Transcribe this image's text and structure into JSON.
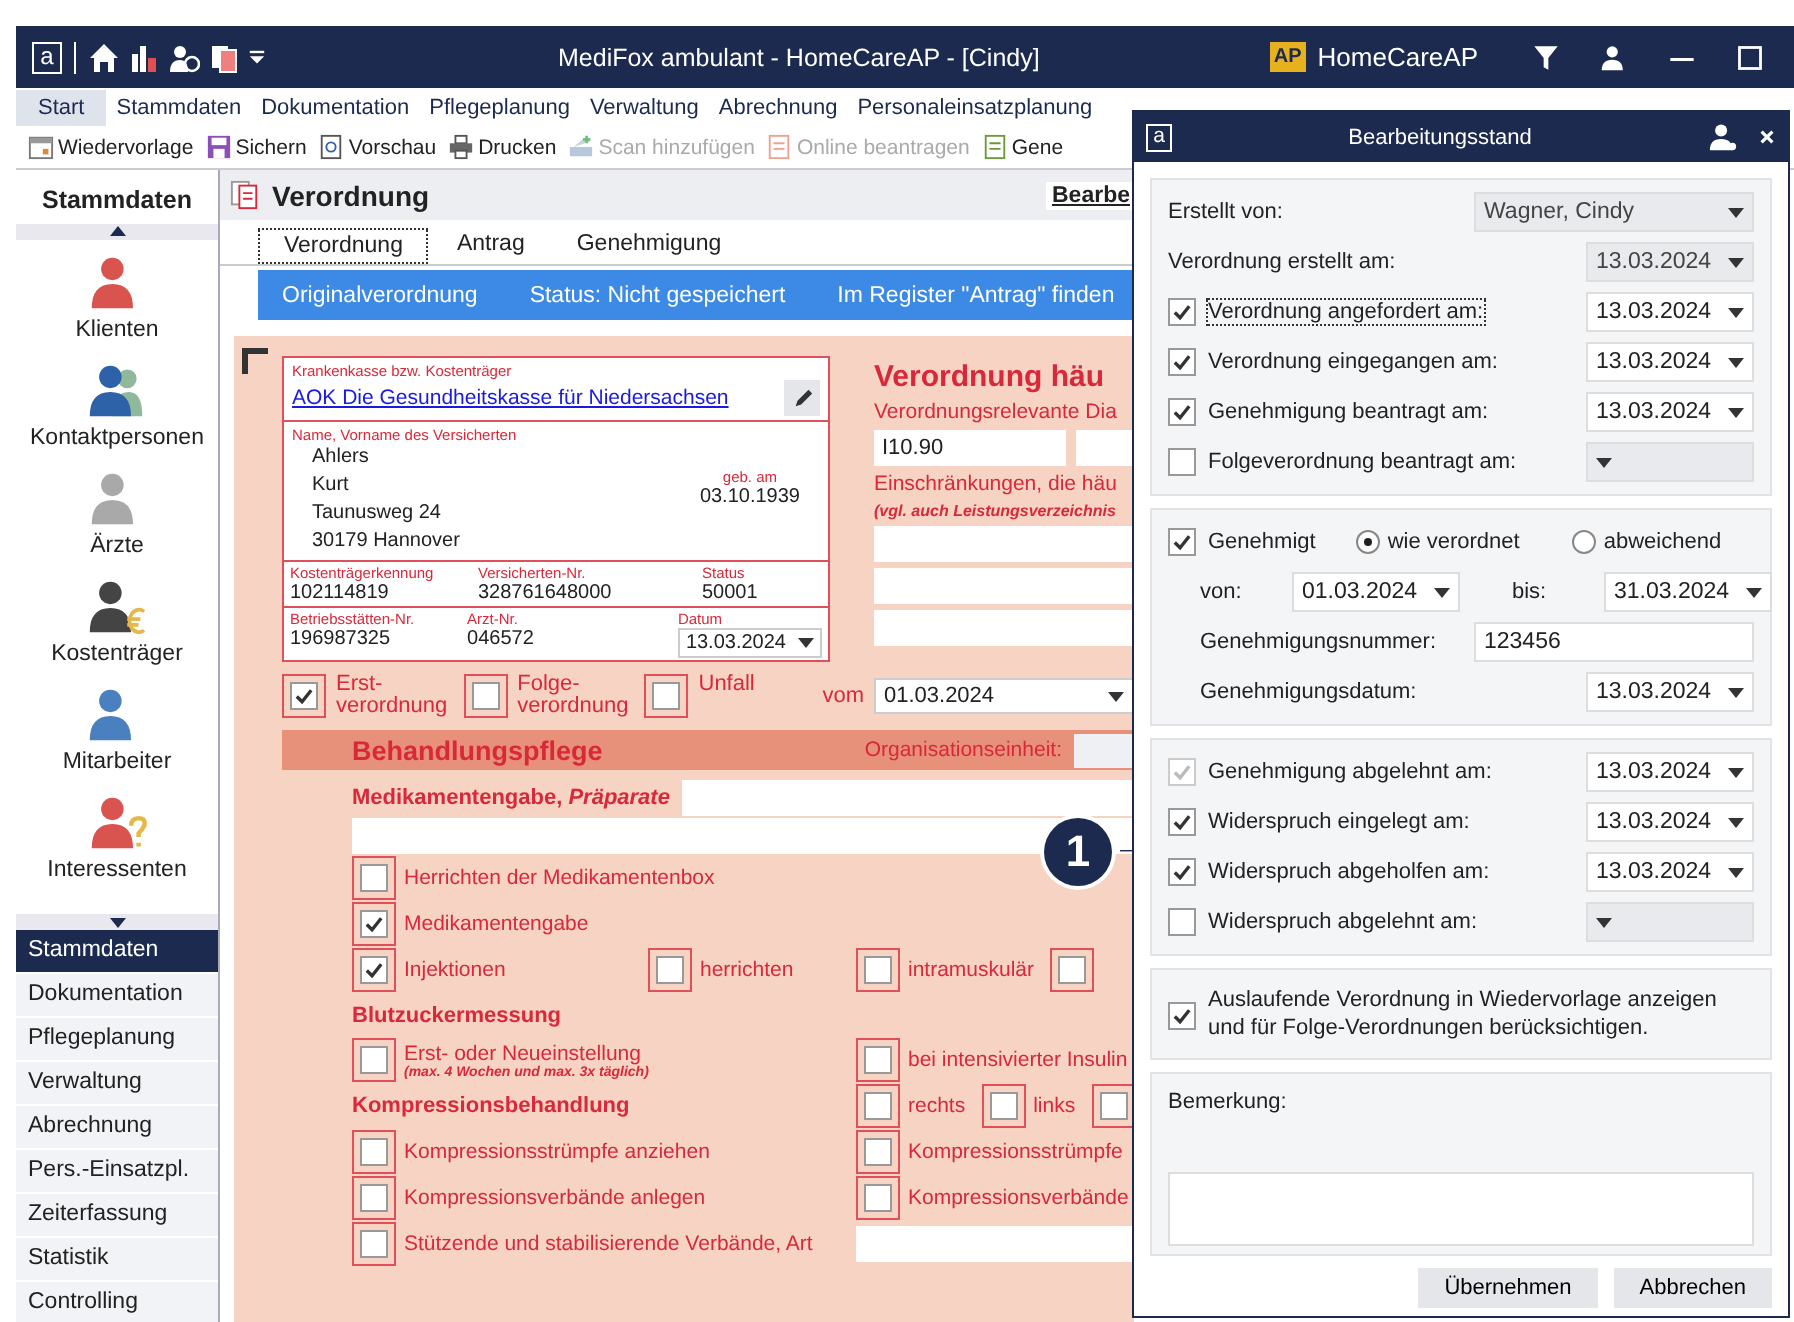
{
  "window": {
    "logo": "a",
    "title": "MediFox ambulant  -  HomeCareAP - [Cindy]",
    "badge": "AP",
    "product": "HomeCareAP"
  },
  "menu": [
    {
      "label": "Start",
      "selected": true
    },
    {
      "label": "Stammdaten",
      "selected": false
    },
    {
      "label": "Dokumentation",
      "selected": false
    },
    {
      "label": "Pflegeplanung",
      "selected": false
    },
    {
      "label": "Verwaltung",
      "selected": false
    },
    {
      "label": "Abrechnung",
      "selected": false
    },
    {
      "label": "Personaleinsatzplanung",
      "selected": false
    }
  ],
  "toolbar": [
    {
      "label": "Wiedervorlage",
      "kind": "calendar",
      "disabled": false
    },
    {
      "label": "Sichern",
      "kind": "save",
      "disabled": false
    },
    {
      "label": "Vorschau",
      "kind": "preview",
      "disabled": false
    },
    {
      "label": "Drucken",
      "kind": "print",
      "disabled": false
    },
    {
      "label": "Scan hinzufügen",
      "kind": "scan",
      "disabled": true
    },
    {
      "label": "Online beantragen",
      "kind": "document",
      "disabled": true
    },
    {
      "label": "Gene",
      "kind": "sheet",
      "disabled": false
    }
  ],
  "sidebar": {
    "title": "Stammdaten",
    "items": [
      {
        "label": "Klienten",
        "kind": "client"
      },
      {
        "label": "Kontaktpersonen",
        "kind": "contacts"
      },
      {
        "label": "Ärzte",
        "kind": "doctor"
      },
      {
        "label": "Kostenträger",
        "kind": "payer"
      },
      {
        "label": "Mitarbeiter",
        "kind": "staff"
      },
      {
        "label": "Interessenten",
        "kind": "prospect"
      }
    ],
    "nav": [
      {
        "label": "Stammdaten",
        "selected": true
      },
      {
        "label": "Dokumentation",
        "selected": false
      },
      {
        "label": "Pflegeplanung",
        "selected": false
      },
      {
        "label": "Verwaltung",
        "selected": false
      },
      {
        "label": "Abrechnung",
        "selected": false
      },
      {
        "label": "Pers.-Einsatzpl.",
        "selected": false
      },
      {
        "label": "Zeiterfassung",
        "selected": false
      },
      {
        "label": "Statistik",
        "selected": false
      },
      {
        "label": "Controlling",
        "selected": false
      }
    ]
  },
  "page": {
    "title": "Verordnung",
    "action": "Bearbe",
    "tabs": [
      {
        "label": "Verordnung",
        "selected": true
      },
      {
        "label": "Antrag",
        "selected": false
      },
      {
        "label": "Genehmigung",
        "selected": false
      }
    ],
    "info": [
      "Originalverordnung",
      "Status: Nicht gespeichert",
      "Im Register \"Antrag\" finden"
    ]
  },
  "form": {
    "insurer_label": "Krankenkasse bzw. Kostenträger",
    "insurer": "AOK Die Gesundheitskasse für Niedersachsen",
    "name_label": "Name, Vorname des Versicherten",
    "name_lines": [
      "Ahlers",
      "Kurt",
      "Taunusweg 24",
      "30179 Hannover"
    ],
    "dob_label": "geb. am",
    "dob": "03.10.1939",
    "id_rows": [
      [
        {
          "label": "Kostenträgerkennung",
          "value": "102114819",
          "kind": "text"
        },
        {
          "label": "Versicherten-Nr.",
          "value": "328761648000",
          "kind": "text"
        },
        {
          "label": "Status",
          "value": "50001",
          "kind": "text"
        }
      ],
      [
        {
          "label": "Betriebsstätten-Nr.",
          "value": "196987325",
          "kind": "text"
        },
        {
          "label": "Arzt-Nr.",
          "value": "046572",
          "kind": "text"
        },
        {
          "label": "Datum",
          "value": "13.03.2024",
          "kind": "date"
        }
      ]
    ],
    "types": [
      {
        "label": "Erst-verordnung",
        "checked": true
      },
      {
        "label": "Folge-verordnung",
        "checked": false
      },
      {
        "label": "Unfall",
        "checked": false
      }
    ],
    "heading": "Verordnung häu",
    "diagnosis_label": "Verordnungsrelevante Dia",
    "diagnoses": [
      "I10.90"
    ],
    "restrictions_label": "Einschränkungen, die häu",
    "restrictions_note": "(vgl. auch Leistungsverzeichnis",
    "from_label": "vom",
    "from": "01.03.2024",
    "section": "Behandlungspflege",
    "org_label": "Organisationseinheit:",
    "med_label": "Medikamentengabe, *Präparate*",
    "rows": [
      {
        "kind": "check",
        "left": [
          {
            "label": "Herrichten der Medikamentenbox",
            "checked": false
          }
        ],
        "right": []
      },
      {
        "kind": "check",
        "left": [
          {
            "label": "Medikamentengabe",
            "checked": true
          }
        ],
        "right": []
      },
      {
        "kind": "check",
        "left": [
          {
            "label": "Injektionen",
            "checked": true
          },
          {
            "label": "herrichten",
            "checked": false
          }
        ],
        "right": [
          {
            "label": "intramuskulär",
            "checked": false
          },
          {
            "checked": false
          }
        ]
      },
      {
        "kind": "heading",
        "label": "Blutzuckermessung"
      },
      {
        "kind": "check",
        "left": [
          {
            "label": "Erst- oder Neueinstellung",
            "note": "(max. 4 Wochen und max. 3x täglich)",
            "checked": false
          }
        ],
        "right": [
          {
            "label": "bei intensivierter Insulin",
            "checked": false
          }
        ]
      },
      {
        "kind": "heading",
        "label": "Kompressionsbehandlung",
        "right": [
          {
            "label": "rechts",
            "checked": false
          },
          {
            "label": "links",
            "checked": false
          },
          {
            "checked": false
          }
        ]
      },
      {
        "kind": "check",
        "left": [
          {
            "label": "Kompressionsstrümpfe anziehen",
            "checked": false
          }
        ],
        "right": [
          {
            "label": "Kompressionsstrümpfe",
            "checked": false
          }
        ]
      },
      {
        "kind": "check",
        "left": [
          {
            "label": "Kompressionsverbände anlegen",
            "checked": false
          }
        ],
        "right": [
          {
            "label": "Kompressionsverbände",
            "checked": false
          }
        ]
      },
      {
        "kind": "field",
        "left": [
          {
            "label": "Stützende und stabilisierende Verbände, Art",
            "checked": false
          }
        ],
        "right": []
      }
    ]
  },
  "callout": "1",
  "dialog": {
    "logo": "a",
    "title": "Bearbeitungsstand",
    "created_by_label": "Erstellt von:",
    "created_by": "Wagner, Cindy",
    "dates": [
      {
        "kind": "plain",
        "label": "Verordnung erstellt am:",
        "date": "13.03.2024",
        "focused": false
      },
      {
        "kind": "check",
        "label": "Verordnung angefordert am:",
        "date": "13.03.2024",
        "checked": true,
        "focused": true
      },
      {
        "kind": "check",
        "label": "Verordnung eingegangen am:",
        "date": "13.03.2024",
        "checked": true,
        "focused": false
      },
      {
        "kind": "check",
        "label": "Genehmigung beantragt am:",
        "date": "13.03.2024",
        "checked": true,
        "focused": false
      },
      {
        "kind": "check",
        "label": "Folgeverordnung beantragt am:",
        "checked": false,
        "focused": false
      }
    ],
    "approved": {
      "label": "Genehmigt",
      "checked": true,
      "options": [
        {
          "label": "wie verordnet",
          "selected": true
        },
        {
          "label": "abweichend",
          "selected": false
        }
      ],
      "from_label": "von:",
      "from": "01.03.2024",
      "to_label": "bis:",
      "to": "31.03.2024",
      "number_label": "Genehmigungsnummer:",
      "number": "123456",
      "date_label": "Genehmigungsdatum:",
      "date": "13.03.2024"
    },
    "objections": [
      {
        "label": "Genehmigung abgelehnt am:",
        "date": "13.03.2024",
        "checked": true,
        "disabled": true
      },
      {
        "label": "Widerspruch eingelegt am:",
        "date": "13.03.2024",
        "checked": true,
        "disabled": false
      },
      {
        "label": "Widerspruch abgeholfen am:",
        "date": "13.03.2024",
        "checked": true,
        "disabled": false
      },
      {
        "label": "Widerspruch abgelehnt am:",
        "checked": false,
        "disabled": false
      }
    ],
    "reminder": {
      "label": "Auslaufende Verordnung in Wiedervorlage anzeigen und für Folge-Verordnungen berücksichtigen.",
      "checked": true
    },
    "remark_label": "Bemerkung:",
    "buttons": [
      "Übernehmen",
      "Abbrechen"
    ]
  }
}
